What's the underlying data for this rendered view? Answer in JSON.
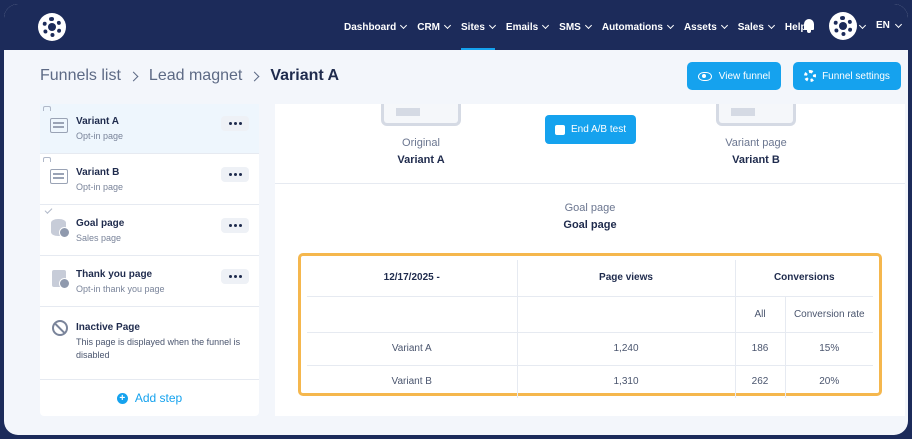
{
  "nav": {
    "items": [
      {
        "label": "Dashboard",
        "dropdown": true,
        "active": false
      },
      {
        "label": "CRM",
        "dropdown": true,
        "active": false
      },
      {
        "label": "Sites",
        "dropdown": true,
        "active": true
      },
      {
        "label": "Emails",
        "dropdown": true,
        "active": false
      },
      {
        "label": "SMS",
        "dropdown": true,
        "active": false
      },
      {
        "label": "Automations",
        "dropdown": true,
        "active": false
      },
      {
        "label": "Assets",
        "dropdown": true,
        "active": false
      },
      {
        "label": "Sales",
        "dropdown": true,
        "active": false
      },
      {
        "label": "Help",
        "dropdown": false,
        "active": false
      }
    ],
    "language": "EN",
    "icons": {
      "logo": "gear-logo-icon",
      "notifications": "bell-icon",
      "avatar": "gear-avatar-icon"
    }
  },
  "breadcrumb": {
    "items": [
      "Funnels list",
      "Lead magnet"
    ],
    "current": "Variant A"
  },
  "header_actions": {
    "view_funnel": "View funnel",
    "funnel_settings": "Funnel settings"
  },
  "sidebar": {
    "steps": [
      {
        "name": "Variant A",
        "subtitle": "Opt-in page",
        "icon": "page-icon",
        "selected": true
      },
      {
        "name": "Variant B",
        "subtitle": "Opt-in page",
        "icon": "page-icon",
        "selected": false
      },
      {
        "name": "Goal page",
        "subtitle": "Sales page",
        "icon": "database-icon",
        "selected": false
      },
      {
        "name": "Thank you page",
        "subtitle": "Opt-in thank you page",
        "icon": "clipboard-icon",
        "selected": false
      },
      {
        "name": "Inactive Page",
        "subtitle": "This page is displayed when the funnel is disabled",
        "icon": "ban-icon",
        "selected": false
      }
    ],
    "add_step": "Add step"
  },
  "ab_test": {
    "original_label": "Original",
    "original_title": "Variant A",
    "end_button": "End A/B test",
    "variant_label": "Variant page",
    "variant_title": "Variant B",
    "goal_label": "Goal page",
    "goal_title": "Goal page"
  },
  "stats": {
    "headers": {
      "date": "12/17/2025 -",
      "page_views": "Page views",
      "conversions": "Conversions",
      "all": "All",
      "rate": "Conversion rate"
    },
    "rows": [
      {
        "variant": "Variant A",
        "page_views": "1,240",
        "all": "186",
        "rate": "15%"
      },
      {
        "variant": "Variant B",
        "page_views": "1,310",
        "all": "262",
        "rate": "20%"
      }
    ]
  },
  "colors": {
    "nav_bg": "#1c2b5a",
    "accent": "#15a2ee",
    "highlight_border": "#f5b74d",
    "page_bg": "#f3f6fb"
  }
}
